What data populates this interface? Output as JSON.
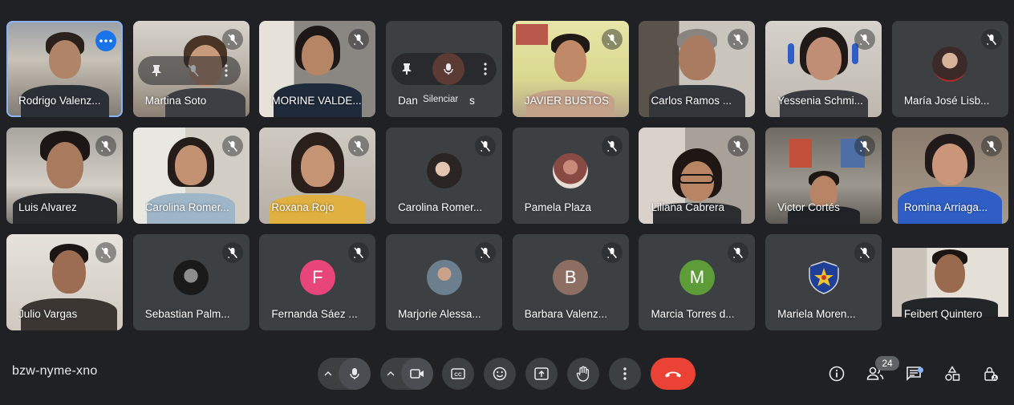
{
  "meeting": {
    "code": "bzw-nyme-xno",
    "participant_count": "24"
  },
  "hover": {
    "tooltip": "Silenciar"
  },
  "participants": [
    {
      "name": "Rodrigo Valenz...",
      "type": "video",
      "muted": false,
      "active": true
    },
    {
      "name": "Martina Soto",
      "type": "video",
      "muted": true
    },
    {
      "name": "MORINE VALDE...",
      "type": "video",
      "muted": true
    },
    {
      "name": "Dan",
      "type": "tile-hover",
      "muted": false
    },
    {
      "name": "JAVIER BUSTOS",
      "type": "video",
      "muted": true
    },
    {
      "name": "Carlos Ramos ...",
      "type": "video",
      "muted": true
    },
    {
      "name": "Yessenia Schmi...",
      "type": "video",
      "muted": true
    },
    {
      "name": "María José Lisb...",
      "type": "avatar-photo",
      "muted": true
    },
    {
      "name": "Luis Alvarez",
      "type": "video",
      "muted": true
    },
    {
      "name": "Carolina Romer...",
      "type": "video",
      "muted": true
    },
    {
      "name": "Roxana Rojo",
      "type": "video",
      "muted": true
    },
    {
      "name": "Carolina Romer...",
      "type": "avatar-photo",
      "muted": true
    },
    {
      "name": "Pamela Plaza",
      "type": "avatar-photo",
      "muted": true
    },
    {
      "name": "Liliana Cabrera",
      "type": "video",
      "muted": true
    },
    {
      "name": "Victor Cortés",
      "type": "video",
      "muted": true
    },
    {
      "name": "Romina Arriaga...",
      "type": "video",
      "muted": true
    },
    {
      "name": "Julio Vargas",
      "type": "video",
      "muted": true
    },
    {
      "name": "Sebastian Palm...",
      "type": "avatar-photo",
      "muted": true
    },
    {
      "name": "Fernanda Sáez ...",
      "type": "avatar-letter",
      "letter": "F",
      "color": "#e8457a",
      "muted": true
    },
    {
      "name": "Marjorie Alessa...",
      "type": "avatar-photo",
      "muted": true
    },
    {
      "name": "Barbara Valenz...",
      "type": "avatar-letter",
      "letter": "B",
      "color": "#8d6e63",
      "muted": true
    },
    {
      "name": "Marcia Torres d...",
      "type": "avatar-letter",
      "letter": "M",
      "color": "#5e9c3a",
      "muted": true
    },
    {
      "name": "Mariela Moren...",
      "type": "avatar-emblem",
      "muted": true
    },
    {
      "name": "Feibert Quintero",
      "type": "video",
      "muted": false
    }
  ],
  "colors": {
    "background": "#202124",
    "tile": "#3c4043",
    "hangup": "#ea4335",
    "accent": "#8ab4f8"
  }
}
